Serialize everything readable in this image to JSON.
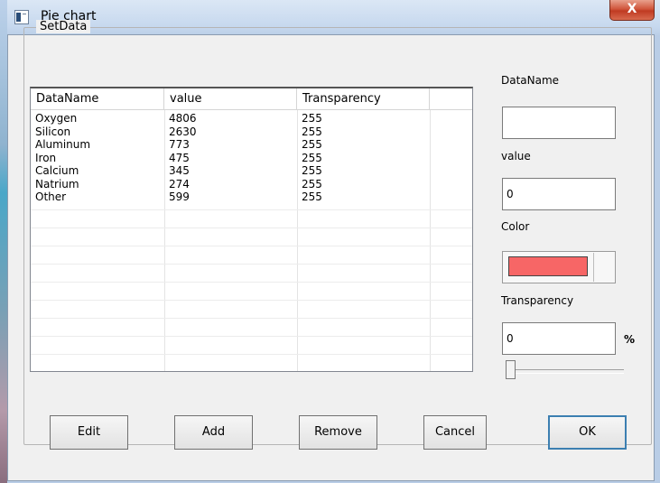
{
  "window": {
    "title": "Pie chart",
    "close_glyph": "X"
  },
  "group": {
    "label": "SetData"
  },
  "table": {
    "columns": [
      "DataName",
      "value",
      "Transparency"
    ],
    "rows": [
      {
        "name": "Oxygen",
        "value": "4806",
        "transparency": "255"
      },
      {
        "name": "Silicon",
        "value": "2630",
        "transparency": "255"
      },
      {
        "name": "Aluminum",
        "value": "773",
        "transparency": "255"
      },
      {
        "name": "Iron",
        "value": "475",
        "transparency": "255"
      },
      {
        "name": "Calcium",
        "value": "345",
        "transparency": "255"
      },
      {
        "name": "Natrium",
        "value": "274",
        "transparency": "255"
      },
      {
        "name": "Other",
        "value": "599",
        "transparency": "255"
      }
    ]
  },
  "form": {
    "dataname_label": "DataName",
    "dataname_value": "",
    "value_label": "value",
    "value_value": "0",
    "color_label": "Color",
    "color_hex": "#f76666",
    "transparency_label": "Transparency",
    "transparency_value": "0",
    "transparency_unit": "%",
    "slider_level": 0
  },
  "buttons": {
    "edit": "Edit",
    "add": "Add",
    "remove": "Remove",
    "cancel": "Cancel",
    "ok": "OK"
  },
  "icons": {
    "app": "window-app-icon",
    "close": "close-icon"
  }
}
